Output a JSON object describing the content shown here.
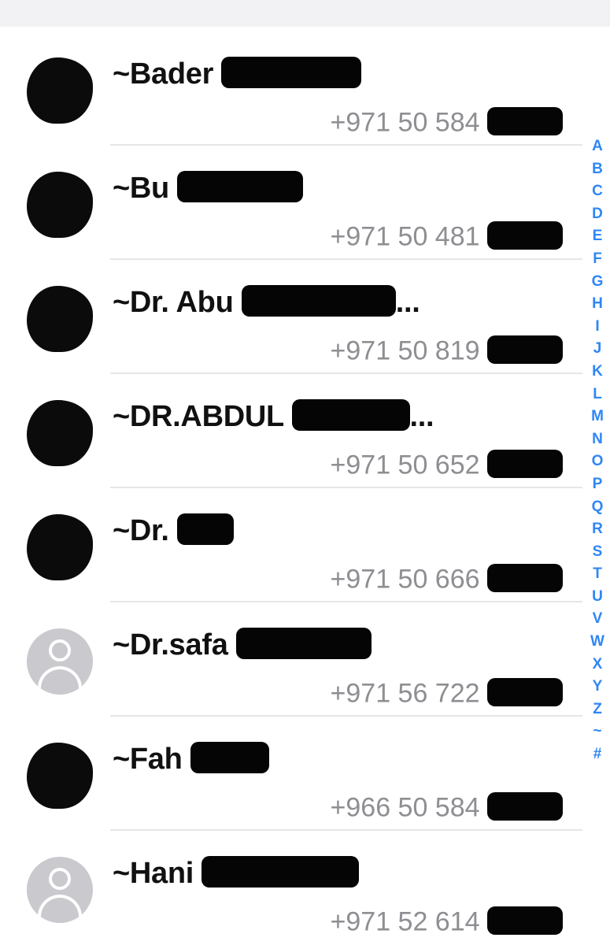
{
  "contacts": [
    {
      "name": "~Bader",
      "phone": "+971 50 584",
      "avatar": "photo-redacted-icon"
    },
    {
      "name": "~Bu",
      "phone": "+971 50 481",
      "avatar": "photo-redacted-icon"
    },
    {
      "name": "~Dr. Abu",
      "name_suffix": "...",
      "phone": "+971 50 819",
      "avatar": "photo-redacted-icon"
    },
    {
      "name": "~DR.ABDUL",
      "name_suffix": "...",
      "phone": "+971 50 652",
      "avatar": "photo-redacted-icon"
    },
    {
      "name": "~Dr.",
      "phone": "+971 50 666",
      "avatar": "photo-redacted-icon"
    },
    {
      "name": "~Dr.safa",
      "phone": "+971 56 722",
      "avatar": "default-person-icon"
    },
    {
      "name": "~Fah",
      "phone": "+966 50 584",
      "avatar": "photo-redacted-icon"
    },
    {
      "name": "~Hani",
      "phone": "+971 52 614",
      "avatar": "default-person-icon"
    }
  ],
  "index_letters": [
    "A",
    "B",
    "C",
    "D",
    "E",
    "F",
    "G",
    "H",
    "I",
    "J",
    "K",
    "L",
    "M",
    "N",
    "O",
    "P",
    "Q",
    "R",
    "S",
    "T",
    "U",
    "V",
    "W",
    "X",
    "Y",
    "Z",
    "~",
    "#"
  ],
  "colors": {
    "accent": "#2f86f6",
    "name_text": "#111111",
    "phone_text": "#8e8e93",
    "redaction": "#050505"
  }
}
